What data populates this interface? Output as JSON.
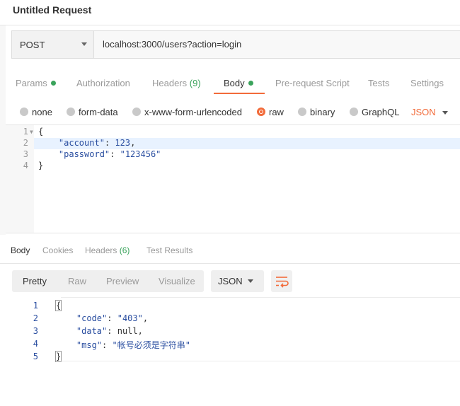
{
  "request": {
    "title": "Untitled Request",
    "method": "POST",
    "url": "localhost:3000/users?action=login"
  },
  "request_tabs": [
    {
      "label": "Params",
      "count": "",
      "dot": true
    },
    {
      "label": "Authorization",
      "count": "",
      "dot": false
    },
    {
      "label": "Headers",
      "count": "(9)",
      "dot": false
    },
    {
      "label": "Body",
      "count": "",
      "dot": true
    },
    {
      "label": "Pre-request Script",
      "count": "",
      "dot": false
    },
    {
      "label": "Tests",
      "count": "",
      "dot": false
    },
    {
      "label": "Settings",
      "count": "",
      "dot": false
    }
  ],
  "body_types": {
    "none": "none",
    "form_data": "form-data",
    "urlencoded": "x-www-form-urlencoded",
    "raw": "raw",
    "binary": "binary",
    "graphql": "GraphQL",
    "format": "JSON",
    "selected": "raw"
  },
  "request_body": {
    "line_numbers": [
      "1",
      "2",
      "3",
      "4"
    ],
    "lines": {
      "l1": "{",
      "l2_key": "\"account\"",
      "l2_val": "123",
      "l3_key": "\"password\"",
      "l3_val": "\"123456\"",
      "l4": "}"
    }
  },
  "response_tabs": [
    {
      "label": "Body",
      "count": ""
    },
    {
      "label": "Cookies",
      "count": ""
    },
    {
      "label": "Headers",
      "count": "(6)"
    },
    {
      "label": "Test Results",
      "count": ""
    }
  ],
  "response_view": {
    "pretty": "Pretty",
    "raw": "Raw",
    "preview": "Preview",
    "visualize": "Visualize",
    "format": "JSON"
  },
  "response_body": {
    "line_numbers": [
      "1",
      "2",
      "3",
      "4",
      "5"
    ],
    "lines": {
      "l1": "{",
      "l2_key": "\"code\"",
      "l2_val": "\"403\"",
      "l3_key": "\"data\"",
      "l3_val": "null",
      "l4_key": "\"msg\"",
      "l4_val": "\"帐号必须是字符串\"",
      "l5": "}"
    }
  },
  "colors": {
    "accent": "#f26b3a",
    "active_dot": "#3aa35b",
    "code_blue": "#2a4ea0"
  }
}
